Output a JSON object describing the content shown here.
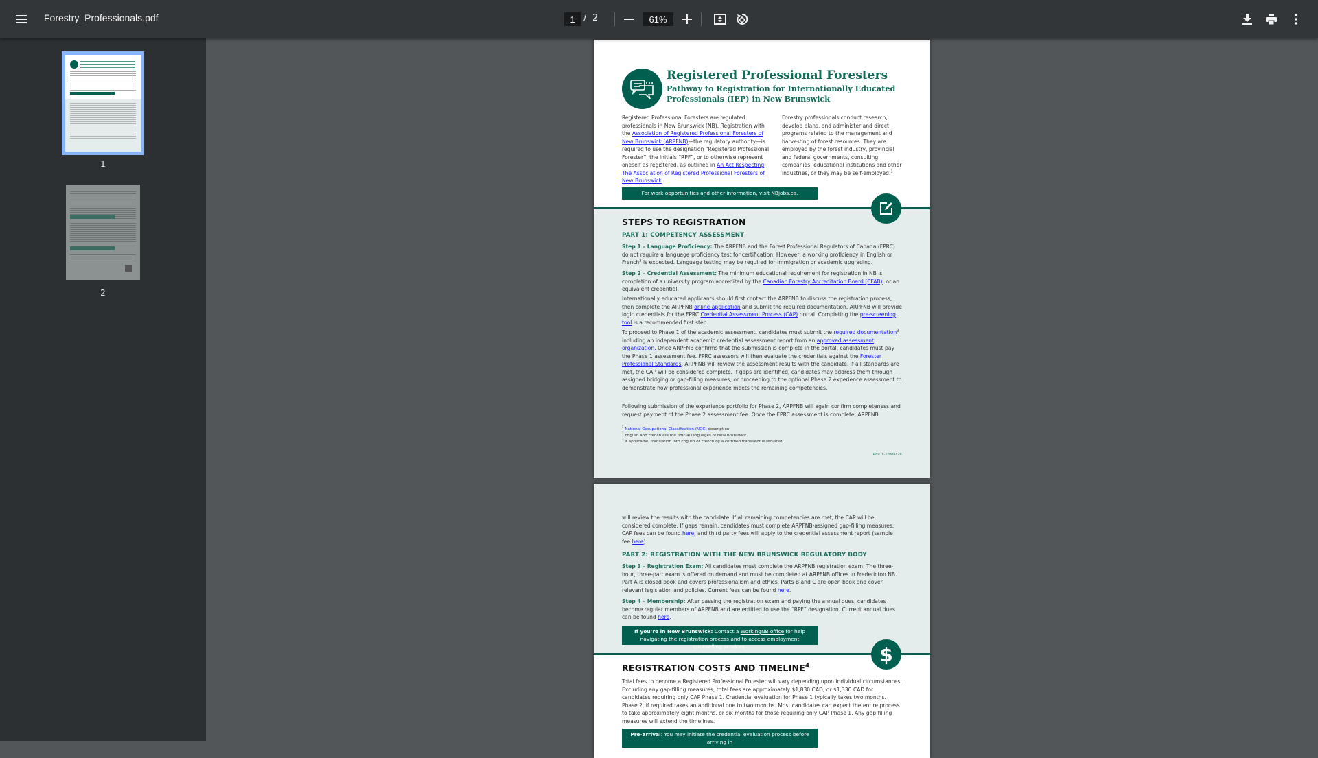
{
  "toolbar": {
    "title": "Forestry_Professionals.pdf",
    "page_current": "1",
    "page_sep": "/",
    "page_total": "2",
    "zoom": "61%",
    "icons": [
      "menu-icon",
      "zoom-out-icon",
      "zoom-in-icon",
      "fit-page-icon",
      "rotate-icon",
      "download-icon",
      "print-icon",
      "more-options-icon"
    ]
  },
  "sidebar": {
    "thumbnails": [
      {
        "label": "1",
        "selected": true
      },
      {
        "label": "2",
        "selected": false
      }
    ]
  },
  "colors": {
    "brand_green": "#005f4e",
    "link": "#1a1aff",
    "section_bg": "#e5edec"
  },
  "page1": {
    "title": "Registered Professional Foresters",
    "subtitle": "Pathway to Registration for Internationally Educated Professionals (IEP) in New Brunswick",
    "intro_left": [
      {
        "t": "Registered Professional Foresters are regulated professionals in New Brunswick (NB). Registration with the "
      },
      {
        "t": "Association of Registered Professional Foresters of New Brunswick (ARPFNB)",
        "link": true
      },
      {
        "t": "—the regulatory authority—is required to use the designation “Registered Professional Forester”, the initials “RPF”, or to otherwise represent oneself as registered, as outlined in "
      },
      {
        "t": "An Act Respecting The Association of Registered Professional Foresters of New Brunswick",
        "link": true
      },
      {
        "t": "."
      }
    ],
    "intro_right": [
      {
        "t": "Forestry professionals conduct research, develop plans, and administer and direct programs related to the management and harvesting of forest resources. They are employed by the forest industry, provincial and federal governments, consulting companies, educational institutions and other industries, or they may be self-employed."
      },
      {
        "t": "1",
        "sup": true
      }
    ],
    "band": [
      {
        "t": "For work opportunities and other information, visit "
      },
      {
        "t": "NBjobs.ca",
        "link": true
      },
      {
        "t": "."
      }
    ],
    "steps_heading": "STEPS TO REGISTRATION",
    "part1_heading": "PART 1: COMPETENCY ASSESSMENT",
    "step1": [
      {
        "t": "Step 1 – Language Proficiency:",
        "bold": true
      },
      {
        "t": " The ARPFNB and the Forest Professional Regulators of Canada (FPRC) do not require a language proficiency test for certification. However, a working proficiency in English or French"
      },
      {
        "t": "2",
        "sup": true
      },
      {
        "t": " is expected. Language testing may be required for immigration or academic upgrading."
      }
    ],
    "step2": [
      {
        "t": "Step 2 – Credential Assessment:",
        "bold": true
      },
      {
        "t": " The minimum educational requirement for registration in NB is completion of a university program accredited by the "
      },
      {
        "t": "Canadian Forestry Accreditation Board (CFAB)",
        "link": true
      },
      {
        "t": ", or an equivalent credential."
      }
    ],
    "intl": [
      {
        "t": "Internationally educated applicants should first contact the ARPFNB to discuss the registration process, then complete the ARPFNB "
      },
      {
        "t": "online application",
        "link": true
      },
      {
        "t": " and submit the required documentation. ARPFNB will provide login credentials for the FPRC "
      },
      {
        "t": "Credential Assessment Process (CAP)",
        "link": true
      },
      {
        "t": " portal. Completing the "
      },
      {
        "t": "pre-screening tool",
        "link": true
      },
      {
        "t": " is a recommended first step."
      }
    ],
    "proceed": [
      {
        "t": "To proceed to Phase 1 of the academic assessment, candidates must submit the "
      },
      {
        "t": "required documentation",
        "link": true
      },
      {
        "t": "3",
        "sup": true
      },
      {
        "t": " including an independent academic credential assessment report from an "
      },
      {
        "t": "approved assessment organization",
        "link": true
      },
      {
        "t": ". Once ARPFNB confirms that the submission is complete in the portal, candidates must pay the Phase 1 assessment fee. FPRC assessors will then evaluate the credentials against the "
      },
      {
        "t": "Forester Professional Standards",
        "link": true
      },
      {
        "t": ". ARPFNB will review the assessment results with the candidate. If all standards are met, the CAP will be considered complete. If gaps are identified, candidates may address them through assigned bridging or gap-filling measures, or proceeding to the optional Phase 2 experience assessment to demonstrate how professional experience meets the remaining competencies."
      }
    ],
    "following": [
      {
        "t": "Following submission of the experience portfolio for Phase 2, ARPFNB will again confirm completeness and request payment of the Phase 2 assessment fee. Once the FPRC assessment is complete, ARPFNB"
      }
    ],
    "footnotes": [
      [
        {
          "t": "1",
          "sup": true
        },
        {
          "t": " "
        },
        {
          "t": "National Occupational Classification (NOC)",
          "link": true
        },
        {
          "t": " description."
        }
      ],
      [
        {
          "t": "2",
          "sup": true
        },
        {
          "t": " English and French are the official languages of New Brunswick."
        }
      ],
      [
        {
          "t": "3",
          "sup": true
        },
        {
          "t": " If applicable, translation into English or French by a certified translator is required."
        }
      ]
    ],
    "revision": "Rev 1-23Mar26"
  },
  "page2": {
    "continued": [
      {
        "t": "will review the results with the candidate. If all remaining competencies are met, the CAP will be considered complete. If gaps remain, candidates must complete ARPFNB-assigned gap-filling measures. CAP fees can be found "
      },
      {
        "t": "here",
        "link": true
      },
      {
        "t": ", and third party fees will apply to the credential assessment report (sample fee "
      },
      {
        "t": "here",
        "link": true
      },
      {
        "t": ")"
      }
    ],
    "part2_heading": "PART 2: REGISTRATION WITH THE NEW BRUNSWICK REGULATORY BODY",
    "step3": [
      {
        "t": "Step 3 – Registration Exam:",
        "bold": true
      },
      {
        "t": " All candidates must complete the ARPFNB registration exam. The three-hour, three-part exam is offered on demand and must be completed at ARPFNB offices in Fredericton NB. Part A is closed book and covers professionalism and ethics. Parts B and C are open book and cover relevant legislation and policies. Current fees can be found "
      },
      {
        "t": "here",
        "link": true
      },
      {
        "t": "."
      }
    ],
    "step4": [
      {
        "t": "Step 4 – Membership:",
        "bold": true
      },
      {
        "t": " After passing the registration exam and paying the annual dues, candidates become regular members of ARPFNB and are entitled to use the “RPF” designation. Current annual dues can be found "
      },
      {
        "t": "here",
        "link": true
      },
      {
        "t": "."
      }
    ],
    "band_nb": [
      {
        "t": "If you’re in New Brunswick:",
        "bold": true
      },
      {
        "t": " Contact a "
      },
      {
        "t": "WorkingNB office",
        "link": true
      },
      {
        "t": " for help navigating the registration process and to access employment counselling services."
      }
    ],
    "costs_heading": "REGISTRATION COSTS AND TIMELINE",
    "costs_sup": "4",
    "costs": [
      {
        "t": "Total fees to become a Registered Professional Forester will vary depending upon individual circumstances. Excluding any gap-filling measures, total fees are approximately $1,830 CAD, or $1,330 CAD for candidates requiring only CAP Phase 1. Credential evaluation for Phase 1 typically takes two months. Phase 2, if required takes an additional one to two months. Most candidates can expect the entire process to take approximately eight months, or six months for those requiring only CAP Phase 1. Any gap filling measures will extend the timelines."
      }
    ],
    "band_pre": [
      {
        "t": "Pre-arrival",
        "bold": true
      },
      {
        "t": ": You may initiate the credential evaluation process before arriving in"
      }
    ]
  }
}
